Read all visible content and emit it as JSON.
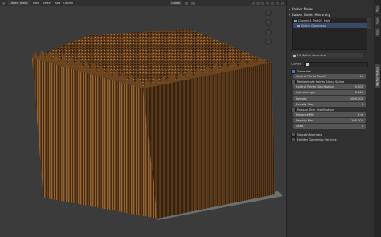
{
  "header": {
    "mode": "Object Mode",
    "menus": [
      "View",
      "Select",
      "Add",
      "Object"
    ],
    "transform": "Global"
  },
  "sidebar_tabs": [
    "Barber Nodes",
    "Tool",
    "View",
    "Item"
  ],
  "panel": {
    "section1_title": "Barber Nodes",
    "hierarchy_title": "Barber Nodes Hierarchy",
    "hierarchy_items": [
      {
        "label": "Groom01_Part01_Hair"
      },
      {
        "label": "Spline Generator"
      }
    ],
    "generator_name": "Fill Spline Generator",
    "curves_label": "Curves",
    "generate_label": "Generate",
    "fields_a": [
      {
        "label": "Control Points Count",
        "value": "16"
      }
    ],
    "redistribute_label": "Redistribute Points Along Spline",
    "fields_b": [
      {
        "label": "Control Points Distribution",
        "value": "0.000"
      },
      {
        "label": "Spline Length",
        "value": "0.060"
      },
      {
        "label": "Density",
        "value": "1000.000"
      },
      {
        "label": "Density Map",
        "value": "1"
      }
    ],
    "poisson_label": "Poisson Disk Distribution",
    "fields_c": [
      {
        "label": "Distance Min",
        "value": "0 m"
      },
      {
        "label": "Density Max",
        "value": "100.000"
      },
      {
        "label": "Seed",
        "value": "0"
      }
    ],
    "smooth_label": "Smooth Normals",
    "emitter_label": "Emitter Geometry Vertices"
  },
  "colors": {
    "accent": "#4a78c2",
    "hair_dark": "#3a2410",
    "hair_light": "#a8743a"
  }
}
